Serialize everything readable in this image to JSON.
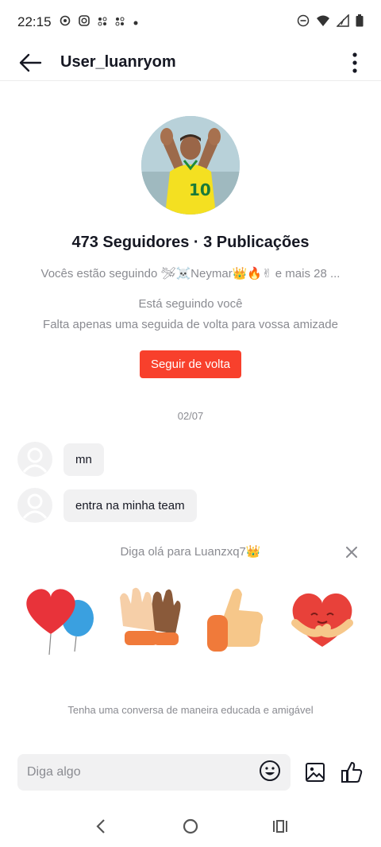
{
  "status_bar": {
    "time": "22:15",
    "left_icons": [
      "location-icon",
      "instagram-icon",
      "app-icon",
      "app-icon",
      "dot-icon"
    ],
    "right_icons": [
      "dnd-icon",
      "wifi-icon",
      "signal-icon",
      "battery-icon"
    ]
  },
  "header": {
    "title": "User_luanryom",
    "back_icon": "arrow-left-icon",
    "more_icon": "more-vertical-icon"
  },
  "profile": {
    "stats": "473 Seguidores · 3 Publicações",
    "following_line": "Vocês estão seguindo 🛩☠️Neymar👑🔥✌ e mais 28 ...",
    "follows_you": "Está seguindo você",
    "friend_hint": "Falta apenas uma seguida de volta para vossa amizade",
    "follow_back_label": "Seguir de volta"
  },
  "chat": {
    "date": "02/07",
    "messages": [
      {
        "text": "mn"
      },
      {
        "text": "entra na minha team"
      }
    ]
  },
  "hello_panel": {
    "title": "Diga olá para Luanzxq7👑",
    "stickers": [
      "heart-balloons-sticker",
      "high-five-sticker",
      "thumbs-up-sticker",
      "heart-hug-sticker"
    ],
    "hint": "Tenha uma conversa de maneira educada e amigável"
  },
  "composer": {
    "placeholder": "Diga algo",
    "emoji_icon": "smiley-icon",
    "image_icon": "image-icon",
    "like_icon": "thumbs-up-icon"
  },
  "nav": {
    "back": "back-nav-icon",
    "home": "home-nav-icon",
    "recents": "recents-nav-icon"
  },
  "colors": {
    "accent": "#f8402c",
    "text_primary": "#161823",
    "text_secondary": "#8a8b91",
    "bubble": "#f1f1f2"
  }
}
